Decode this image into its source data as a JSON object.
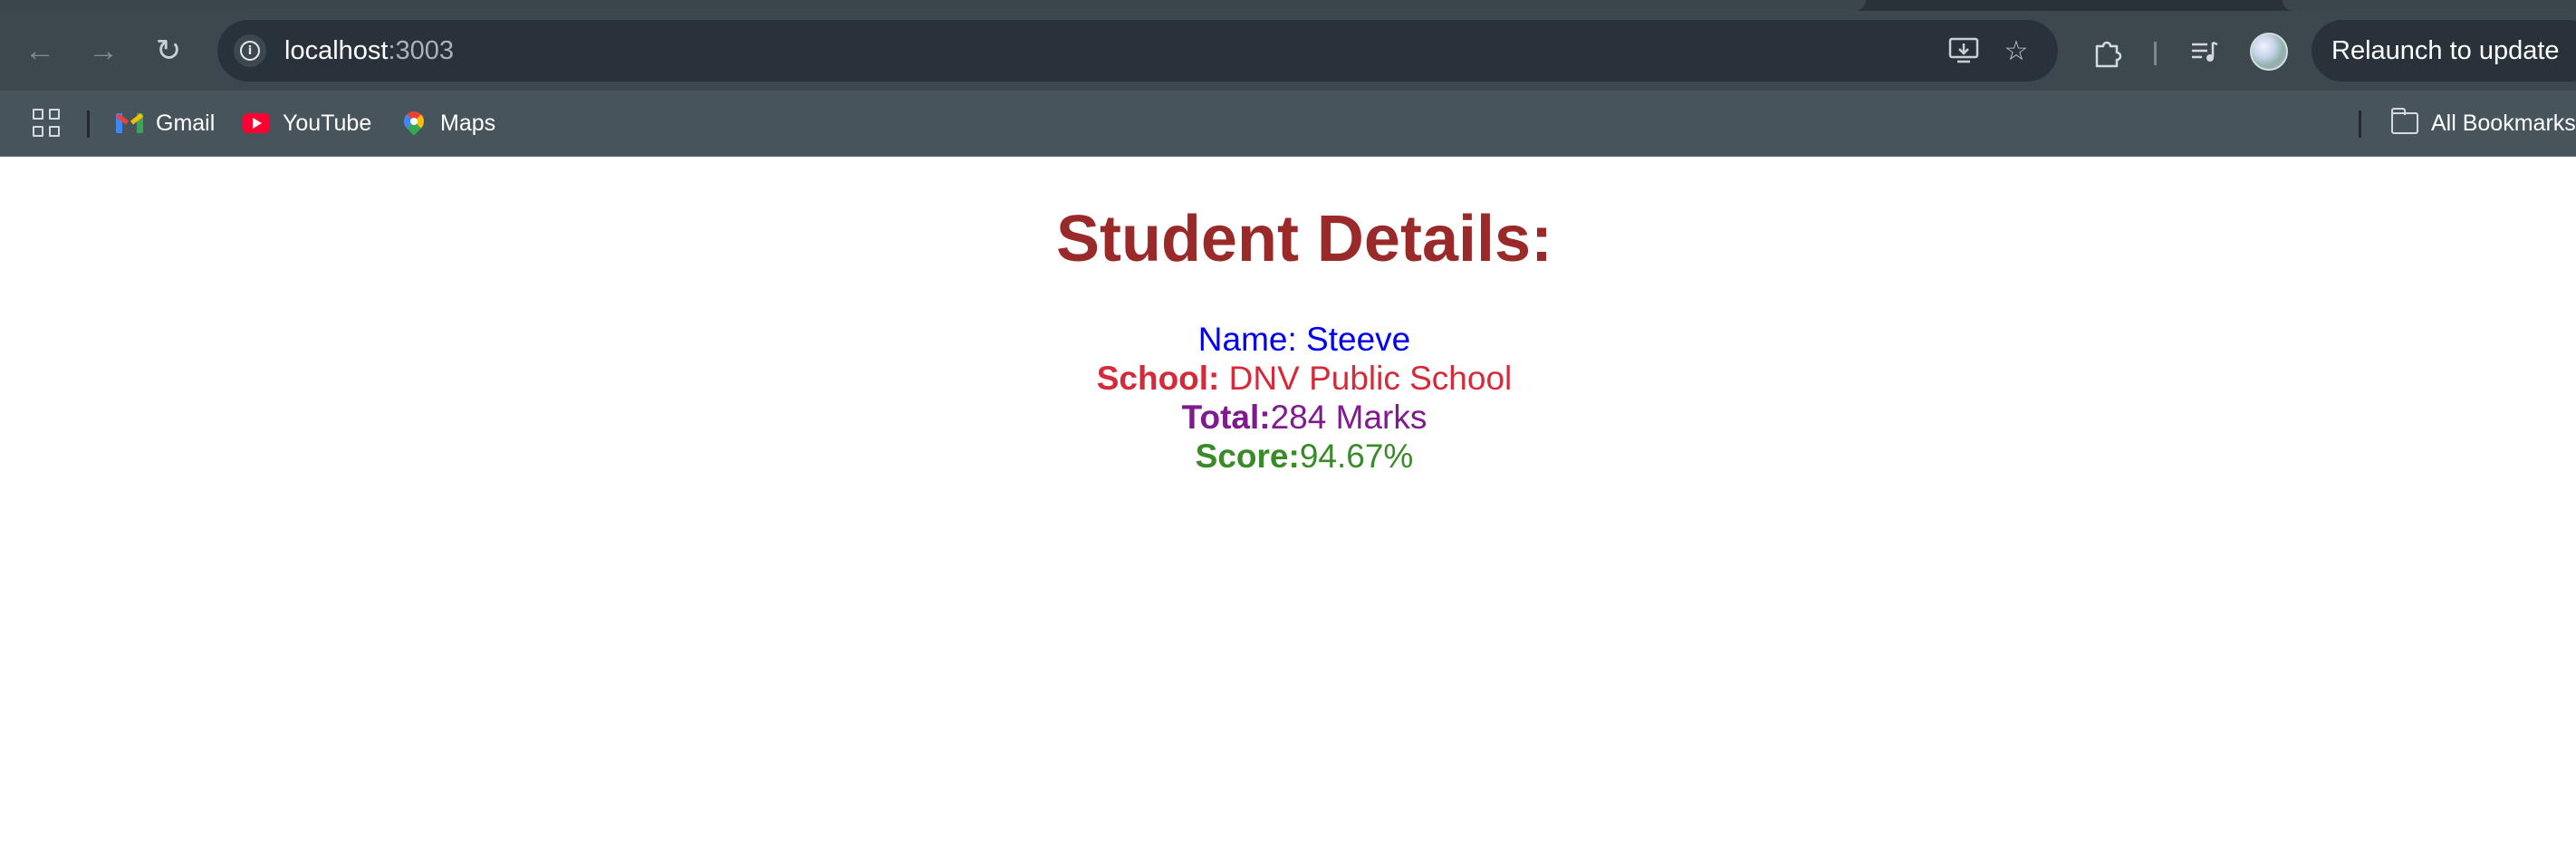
{
  "browser": {
    "url_host": "localhost",
    "url_port": ":3003",
    "relaunch_label": "Relaunch to update",
    "bookmarks": [
      {
        "label": "Gmail"
      },
      {
        "label": "YouTube"
      },
      {
        "label": "Maps"
      }
    ],
    "all_bookmarks_label": "All Bookmarks"
  },
  "page": {
    "heading": "Student Details:",
    "name_label": "Name:",
    "name_value": " Steeve",
    "school_label": "School:",
    "school_value": " DNV Public School",
    "total_label": "Total:",
    "total_value": "284 Marks",
    "score_label": "Score:",
    "score_value": "94.67%"
  },
  "colors": {
    "heading": "#9a2a2a",
    "name": "#0000ee",
    "school": "#d42a3a",
    "total": "#7f1a8f",
    "score": "#3a8a2a"
  }
}
